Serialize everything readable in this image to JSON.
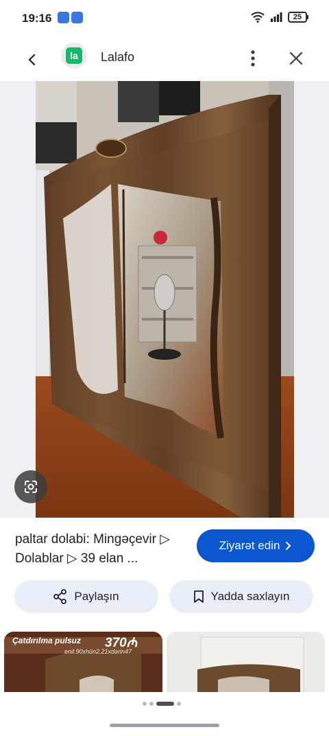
{
  "status_bar": {
    "time": "19:16",
    "battery": "25",
    "notification_icons": [
      "app-notification-icon",
      "app-notification-icon"
    ]
  },
  "app_bar": {
    "logo_text": "la",
    "title": "Lalafo"
  },
  "listing": {
    "title": "paltar dolabi: Mingəçevir ▷ Dolablar ▷ 39 elan ...",
    "visit_label": "Ziyarət edin"
  },
  "actions": {
    "share_label": "Paylaşın",
    "save_label": "Yadda saxlayın"
  },
  "related": [
    {
      "promo_text": "Çatdırılma pulsuz",
      "price": "370₼",
      "subtext": "enil.90xhün2.21xdərin47"
    },
    {}
  ],
  "pager": {
    "count": 4,
    "active_index": 2
  },
  "colors": {
    "accent": "#0b57d0",
    "chip_bg": "#e8eef8",
    "brand_green": "#17b86b",
    "wood": "#6b4a2e"
  },
  "icons": [
    "back-arrow-icon",
    "more-vert-icon",
    "close-icon",
    "google-lens-icon",
    "share-icon",
    "bookmark-icon",
    "chevron-right-icon",
    "wifi-icon",
    "signal-icon",
    "battery-icon"
  ]
}
